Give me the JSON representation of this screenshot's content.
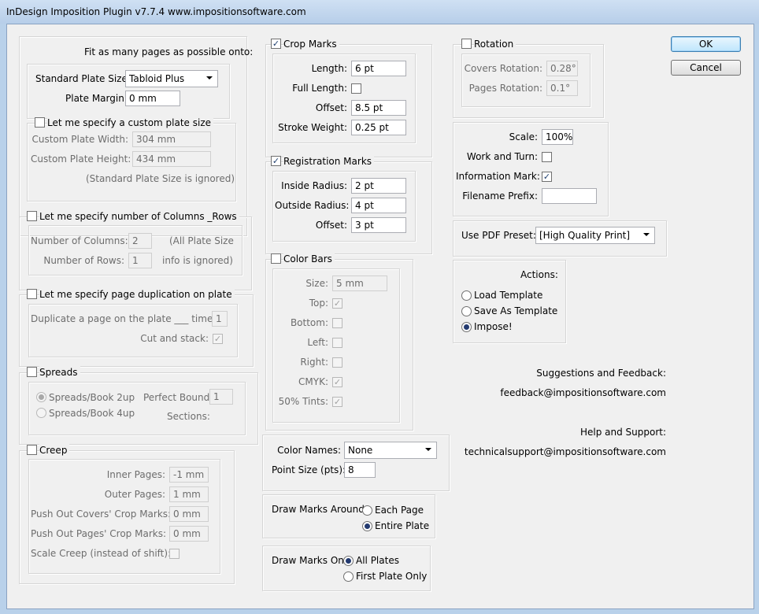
{
  "window": {
    "title": "InDesign Imposition Plugin v7.7.4   www.impositionsoftware.com"
  },
  "buttons": {
    "ok": "OK",
    "cancel": "Cancel"
  },
  "fit": {
    "header": "Fit as many pages as possible onto:",
    "plate_size_label": "Standard Plate Size:",
    "plate_size_value": "Tabloid Plus",
    "margin_label": "Plate Margin:",
    "margin_value": "0 mm"
  },
  "custom_plate": {
    "label": "Let me specify a custom plate size",
    "width_label": "Custom Plate Width:",
    "width_value": "304 mm",
    "height_label": "Custom Plate Height:",
    "height_value": "434 mm",
    "note": "(Standard  Plate Size is ignored)"
  },
  "columns_rows": {
    "label": "Let me specify number of Columns _Rows",
    "cols_label": "Number of Columns:",
    "cols_value": "2",
    "rows_label": "Number of Rows:",
    "rows_value": "1",
    "note1": "(All Plate Size",
    "note2": "info is ignored)"
  },
  "duplication": {
    "label": "Let me specify page duplication on plate",
    "dup_label": "Duplicate a page on the plate ___ times:",
    "dup_value": "1",
    "cut_label": "Cut and stack:"
  },
  "spreads": {
    "label": "Spreads",
    "opt1": "Spreads/Book 2up",
    "opt2": "Spreads/Book 4up",
    "perfect_label": "Perfect Bound",
    "perfect_value": "1",
    "sections_label": "Sections:"
  },
  "creep": {
    "label": "Creep",
    "inner_label": "Inner Pages:",
    "inner_value": "-1 mm",
    "outer_label": "Outer Pages:",
    "outer_value": "1 mm",
    "covers_label": "Push Out Covers' Crop Marks:",
    "covers_value": "0 mm",
    "pages_label": "Push Out Pages' Crop Marks:",
    "pages_value": "0 mm",
    "scale_label": "Scale Creep (instead of shift):"
  },
  "crop": {
    "label": "Crop Marks",
    "length_label": "Length:",
    "length_value": "6 pt",
    "full_label": "Full Length:",
    "offset_label": "Offset:",
    "offset_value": "8.5 pt",
    "stroke_label": "Stroke Weight:",
    "stroke_value": "0.25 pt"
  },
  "registration": {
    "label": "Registration Marks",
    "inside_label": "Inside Radius:",
    "inside_value": "2 pt",
    "outside_label": "Outside Radius:",
    "outside_value": "4 pt",
    "offset_label": "Offset:",
    "offset_value": "3 pt"
  },
  "color_bars": {
    "label": "Color Bars",
    "size_label": "Size:",
    "size_value": "5 mm",
    "top_label": "Top:",
    "bottom_label": "Bottom:",
    "left_label": "Left:",
    "right_label": "Right:",
    "cmyk_label": "CMYK:",
    "tints_label": "50% Tints:"
  },
  "color_names": {
    "label": "Color Names:",
    "value": "None",
    "point_label": "Point Size (pts):",
    "point_value": "8"
  },
  "marks_around": {
    "label": "Draw Marks Around:",
    "opt1": "Each Page",
    "opt2": "Entire Plate"
  },
  "marks_on": {
    "label": "Draw Marks On:",
    "opt1": "All Plates",
    "opt2": "First Plate Only"
  },
  "rotation": {
    "label": "Rotation",
    "covers_label": "Covers Rotation:",
    "covers_value": "0.28°",
    "pages_label": "Pages Rotation:",
    "pages_value": "0.1°"
  },
  "scale_panel": {
    "scale_label": "Scale:",
    "scale_value": "100%",
    "work_label": "Work and Turn:",
    "info_label": "Information Mark:",
    "prefix_label": "Filename Prefix:",
    "prefix_value": ""
  },
  "pdf": {
    "label": "Use PDF Preset:",
    "value": "[High Quality Print]"
  },
  "actions": {
    "label": "Actions:",
    "opt1": "Load Template",
    "opt2": "Save As Template",
    "opt3": "Impose!"
  },
  "support": {
    "feedback_label": "Suggestions and Feedback:",
    "feedback_email": "feedback@impositionsoftware.com",
    "help_label": "Help and Support:",
    "help_email": "technicalsupport@impositionsoftware.com"
  },
  "check_glyph": "✓"
}
